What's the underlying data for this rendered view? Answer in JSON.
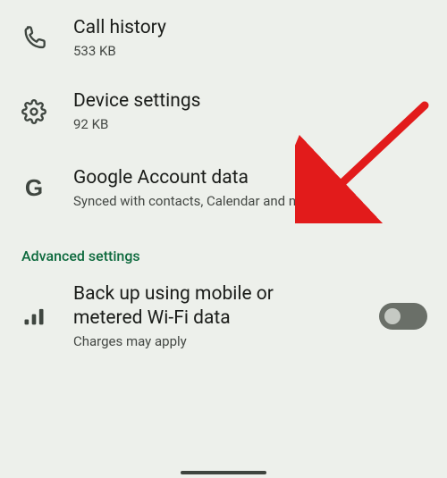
{
  "items": [
    {
      "icon": "phone-icon",
      "title": "Call history",
      "sub": "533 KB"
    },
    {
      "icon": "gear-icon",
      "title": "Device settings",
      "sub": "92 KB"
    },
    {
      "icon": "g-logo-icon",
      "title": "Google Account data",
      "sub": "Synced with contacts, Calendar and more"
    }
  ],
  "section": {
    "label": "Advanced settings"
  },
  "backup": {
    "title": "Back up using mobile or metered Wi-Fi data",
    "sub": "Charges may apply",
    "enabled": false
  }
}
